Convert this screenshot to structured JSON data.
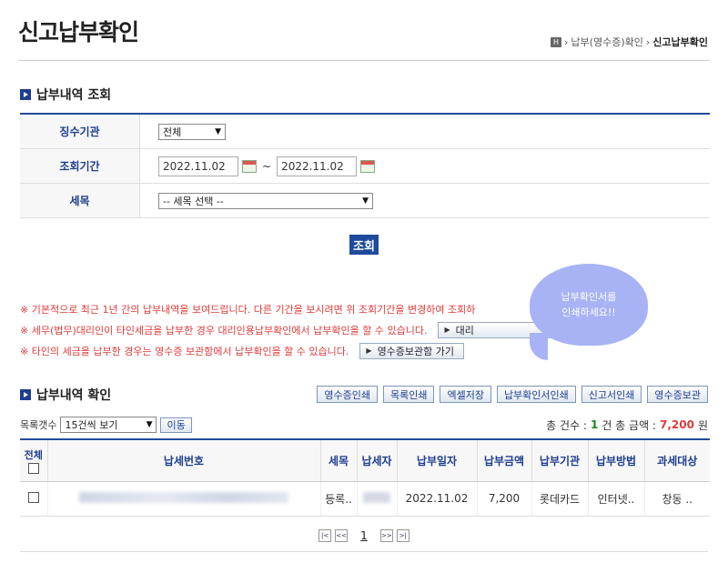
{
  "page": {
    "title": "신고납부확인",
    "breadcrumb": {
      "home_icon": "H",
      "items": [
        "납부(영수증)확인",
        "신고납부확인"
      ]
    }
  },
  "query": {
    "section_title": "납부내역 조회",
    "agency_label": "징수기관",
    "agency_value": "전체",
    "period_label": "조회기간",
    "date_from": "2022.11.02",
    "date_to": "2022.11.02",
    "tax_label": "세목",
    "tax_value": "-- 세목 선택 --",
    "search_button": "조회"
  },
  "notices": [
    {
      "text": "※ 기본적으로 최근 1년 간의 납부내역을 보여드립니다. 다른 기간을 보시려면 위 조회기간을 변경하여 조회하"
    },
    {
      "text": "※ 세무(법무)대리인이 타인세금을 납부한 경우 대리인용납부확인에서 납부확인을 할 수 있습니다.",
      "button": "대리"
    },
    {
      "text": "※ 타인의 세금을 납부한 경우는 영수증 보관함에서 납부확인을 할 수 있습니다.",
      "button": "영수증보관함 가기"
    }
  ],
  "annotation": {
    "line1": "납부확인서를",
    "line2": "인쇄하세요!!"
  },
  "results": {
    "section_title": "납부내역 확인",
    "tools": [
      "영수증인쇄",
      "목록인쇄",
      "엑셀저장",
      "납부확인서인쇄",
      "신고서인쇄",
      "영수증보관"
    ],
    "page_size_label": "목록갯수",
    "page_size_value": "15건씩 보기",
    "move_button": "이동",
    "total_count_label": "총 건수 :",
    "total_count": "1",
    "total_amount_label": "건 총 금액 :",
    "total_amount": "7,200",
    "currency": "원",
    "columns": [
      "전체",
      "납세번호",
      "세목",
      "납세자",
      "납부일자",
      "납부금액",
      "납부기관",
      "납부방법",
      "과세대상"
    ],
    "rows": [
      {
        "tax_item": "등록..",
        "date": "2022.11.02",
        "amount": "7,200",
        "agency": "롯데카드",
        "method": "인터넷..",
        "target": "창동 .."
      }
    ]
  },
  "pagination": {
    "first": "|<",
    "prev": "<<",
    "current": "1",
    "next": ">>",
    "last": ">|"
  },
  "colors": {
    "accent": "#1e3d8f",
    "notice": "#e03a3a",
    "bubble": "#a7b3f5"
  }
}
